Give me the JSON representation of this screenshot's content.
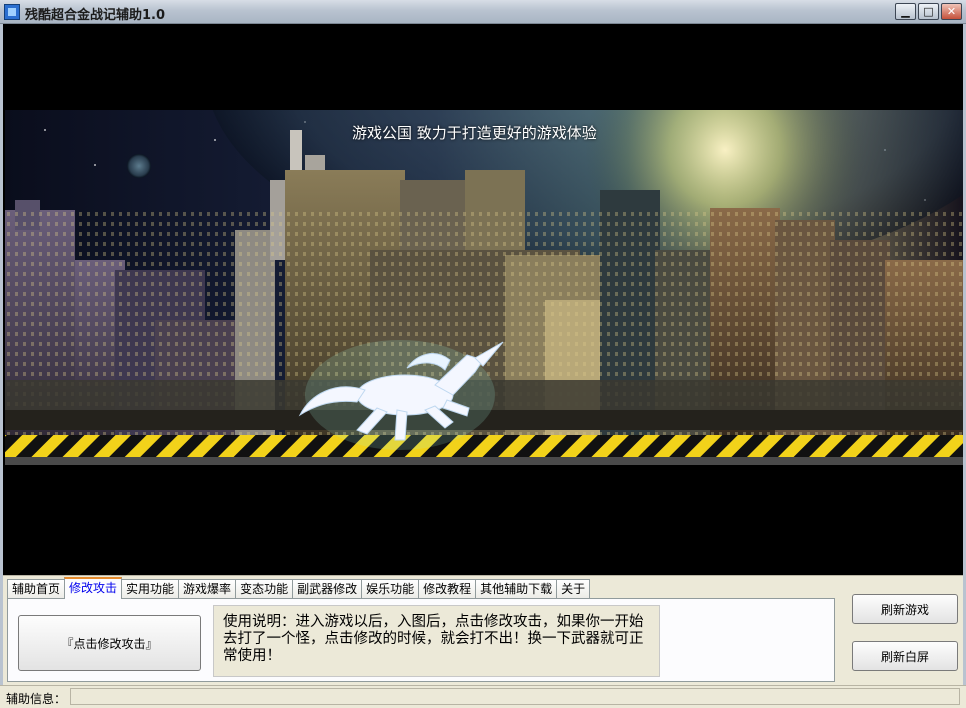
{
  "window": {
    "title": "残酷超合金战记辅助1.0",
    "minimize_glyph": "▁",
    "maximize_glyph": "□",
    "close_glyph": "✕"
  },
  "banner": {
    "caption": "游戏公国 致力于打造更好的游戏体验"
  },
  "tabs": [
    {
      "label": "辅助首页"
    },
    {
      "label": "修改攻击",
      "active": true
    },
    {
      "label": "实用功能"
    },
    {
      "label": "游戏爆率"
    },
    {
      "label": "变态功能"
    },
    {
      "label": "副武器修改"
    },
    {
      "label": "娱乐功能"
    },
    {
      "label": "修改教程"
    },
    {
      "label": "其他辅助下载"
    },
    {
      "label": "关于"
    }
  ],
  "attack_tab": {
    "modify_button": "『点击修改攻击』",
    "description": "使用说明：进入游戏以后，入图后，点击修改攻击，如果你一开始去打了一个怪，点击修改的时候，就会打不出！换一下武器就可正常使用！"
  },
  "side_buttons": {
    "refresh_game": "刷新游戏",
    "refresh_blank": "刷新白屏"
  },
  "status": {
    "label": "辅助信息：",
    "value": ""
  },
  "colors": {
    "active_tab_text": "#0000ee",
    "active_tab_accent": "#e68b2c",
    "panel_bg": "#ece9d8",
    "hazard_yellow": "#f2d21a"
  }
}
